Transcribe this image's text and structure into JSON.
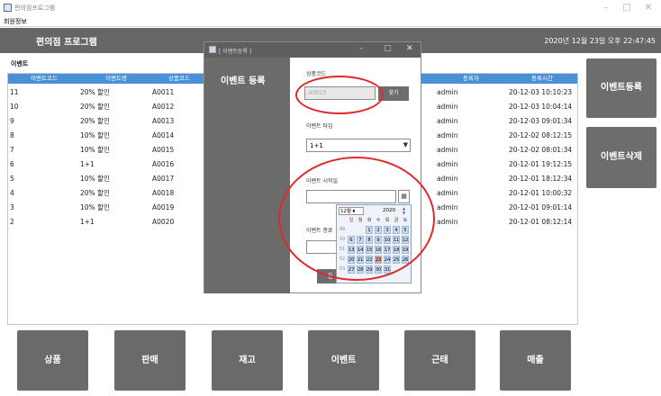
{
  "window": {
    "title": "편의점프로그램"
  },
  "menu": {
    "item": "회원정보"
  },
  "header": {
    "title": "편의점 프로그램",
    "datetime": "2020년 12월 23일 오후 22:47:45"
  },
  "section_label": "이벤트",
  "table": {
    "columns": [
      "이벤트코드",
      "이벤트명",
      "상품코드",
      "등록자",
      "등록시간"
    ],
    "rows": [
      [
        "11",
        "20% 할인",
        "A0011",
        "admin",
        "20-12-03 10:10:23"
      ],
      [
        "10",
        "20% 할인",
        "A0012",
        "admin",
        "20-12-03 10:04:14"
      ],
      [
        "9",
        "20% 할인",
        "A0013",
        "admin",
        "20-12-03 09:01:34"
      ],
      [
        "8",
        "10% 할인",
        "A0014",
        "admin",
        "20-12-02 08:12:15"
      ],
      [
        "7",
        "10% 할인",
        "A0015",
        "admin",
        "20-12-02 08:01:34"
      ],
      [
        "6",
        "1+1",
        "A0016",
        "admin",
        "20-12-01 19:12:15"
      ],
      [
        "5",
        "10% 할인",
        "A0017",
        "admin",
        "20-12-01 18:12:34"
      ],
      [
        "4",
        "20% 할인",
        "A0018",
        "admin",
        "20-12-01 10:00:32"
      ],
      [
        "3",
        "10% 할인",
        "A0019",
        "admin",
        "20-12-01 09:01:14"
      ],
      [
        "2",
        "1+1",
        "A0020",
        "admin",
        "20-12-01 08:12:14"
      ]
    ]
  },
  "side_buttons": {
    "register": "이벤트등록",
    "delete": "이벤트삭제"
  },
  "nav": [
    "상품",
    "판매",
    "재고",
    "이벤트",
    "근태",
    "매출"
  ],
  "dialog": {
    "title": "[ 이벤트등록 ]",
    "heading": "이벤트 등록",
    "product_code_label": "상품코드",
    "product_code_value": "A0015",
    "search_button": "찾기",
    "type_label": "이벤트 타입",
    "type_value": "1+1",
    "start_label": "이벤트 시작일",
    "end_label": "이벤트 종료",
    "submit_label": "등"
  },
  "calendar": {
    "month": "12월",
    "year": "2020",
    "weekdays": [
      "일",
      "월",
      "화",
      "수",
      "목",
      "금",
      "토"
    ],
    "weeks": [
      {
        "wk": "49",
        "days": [
          "",
          "",
          "1",
          "2",
          "3",
          "4",
          "5"
        ]
      },
      {
        "wk": "50",
        "days": [
          "6",
          "7",
          "8",
          "9",
          "10",
          "11",
          "12"
        ]
      },
      {
        "wk": "51",
        "days": [
          "13",
          "14",
          "15",
          "16",
          "17",
          "18",
          "19"
        ]
      },
      {
        "wk": "52",
        "days": [
          "20",
          "21",
          "22",
          "23",
          "24",
          "25",
          "26"
        ]
      },
      {
        "wk": "53",
        "days": [
          "27",
          "28",
          "29",
          "30",
          "31",
          "",
          ""
        ]
      }
    ],
    "today": "23",
    "accent": "#e8a07a"
  }
}
